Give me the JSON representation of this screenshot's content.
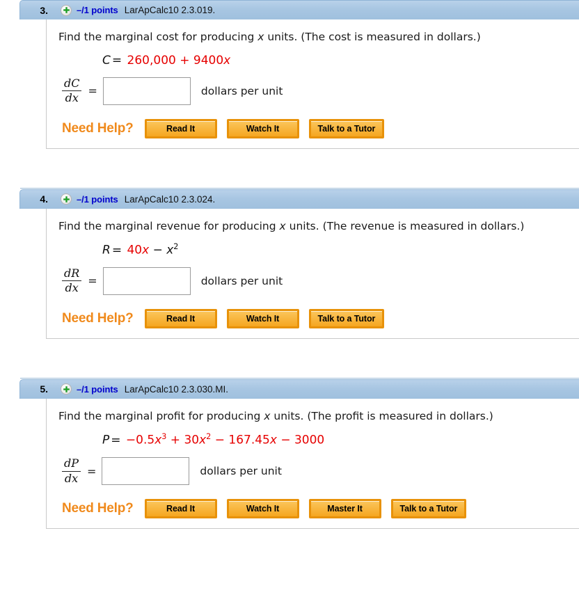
{
  "colors": {
    "header_blue": "#a8c6e2",
    "points_blue": "#0000cc",
    "formula_red": "#e60000",
    "need_help_orange": "#f08a1c",
    "button_orange": "#e8920a"
  },
  "icons": {
    "expand": "plus-circle-icon"
  },
  "questions": [
    {
      "number": "3.",
      "points": "–/1 points",
      "code": "LarApCalc10 2.3.019.",
      "prompt_pre": "Find the marginal cost for producing ",
      "prompt_var": "x",
      "prompt_post": " units. (The cost is measured in dollars.)",
      "formula": {
        "lhs": "C",
        "eq": "=",
        "terms": [
          {
            "text": "260,000",
            "color": "red",
            "italic": false,
            "sup": ""
          },
          {
            "text": " + ",
            "color": "red",
            "italic": false,
            "sup": ""
          },
          {
            "text": "9400",
            "color": "red",
            "italic": false,
            "sup": ""
          },
          {
            "text": "x",
            "color": "red",
            "italic": true,
            "sup": ""
          }
        ]
      },
      "derivative_num": "dC",
      "derivative_den": "dx",
      "equals": "=",
      "input_value": "",
      "input_placeholder": "",
      "units": "dollars per unit",
      "need_help_label": "Need Help?",
      "buttons": [
        "Read It",
        "Watch It",
        "Talk to a Tutor"
      ]
    },
    {
      "number": "4.",
      "points": "–/1 points",
      "code": "LarApCalc10 2.3.024.",
      "prompt_pre": "Find the marginal revenue for producing ",
      "prompt_var": "x",
      "prompt_post": " units. (The revenue is measured in dollars.)",
      "formula": {
        "lhs": "R",
        "eq": "=",
        "terms": [
          {
            "text": "40",
            "color": "red",
            "italic": false,
            "sup": ""
          },
          {
            "text": "x",
            "color": "red",
            "italic": true,
            "sup": ""
          },
          {
            "text": " − ",
            "color": "black",
            "italic": false,
            "sup": ""
          },
          {
            "text": "x",
            "color": "black",
            "italic": true,
            "sup": "2"
          }
        ]
      },
      "derivative_num": "dR",
      "derivative_den": "dx",
      "equals": "=",
      "input_value": "",
      "input_placeholder": "",
      "units": "dollars per unit",
      "need_help_label": "Need Help?",
      "buttons": [
        "Read It",
        "Watch It",
        "Talk to a Tutor"
      ]
    },
    {
      "number": "5.",
      "points": "–/1 points",
      "code": "LarApCalc10 2.3.030.MI.",
      "prompt_pre": "Find the marginal profit for producing ",
      "prompt_var": "x",
      "prompt_post": " units. (The profit is measured in dollars.)",
      "formula": {
        "lhs": "P",
        "eq": "=",
        "terms": [
          {
            "text": "−0.5",
            "color": "red",
            "italic": false,
            "sup": ""
          },
          {
            "text": "x",
            "color": "red",
            "italic": true,
            "sup": "3"
          },
          {
            "text": " + ",
            "color": "red",
            "italic": false,
            "sup": ""
          },
          {
            "text": "30",
            "color": "red",
            "italic": false,
            "sup": ""
          },
          {
            "text": "x",
            "color": "red",
            "italic": true,
            "sup": "2"
          },
          {
            "text": " − ",
            "color": "red",
            "italic": false,
            "sup": ""
          },
          {
            "text": "167.45",
            "color": "red",
            "italic": false,
            "sup": ""
          },
          {
            "text": "x",
            "color": "red",
            "italic": true,
            "sup": ""
          },
          {
            "text": " − ",
            "color": "red",
            "italic": false,
            "sup": ""
          },
          {
            "text": "3000",
            "color": "red",
            "italic": false,
            "sup": ""
          }
        ]
      },
      "derivative_num": "dP",
      "derivative_den": "dx",
      "equals": "=",
      "input_value": "",
      "input_placeholder": "",
      "units": "dollars per unit",
      "need_help_label": "Need Help?",
      "buttons": [
        "Read It",
        "Watch It",
        "Master It",
        "Talk to a Tutor"
      ]
    }
  ]
}
